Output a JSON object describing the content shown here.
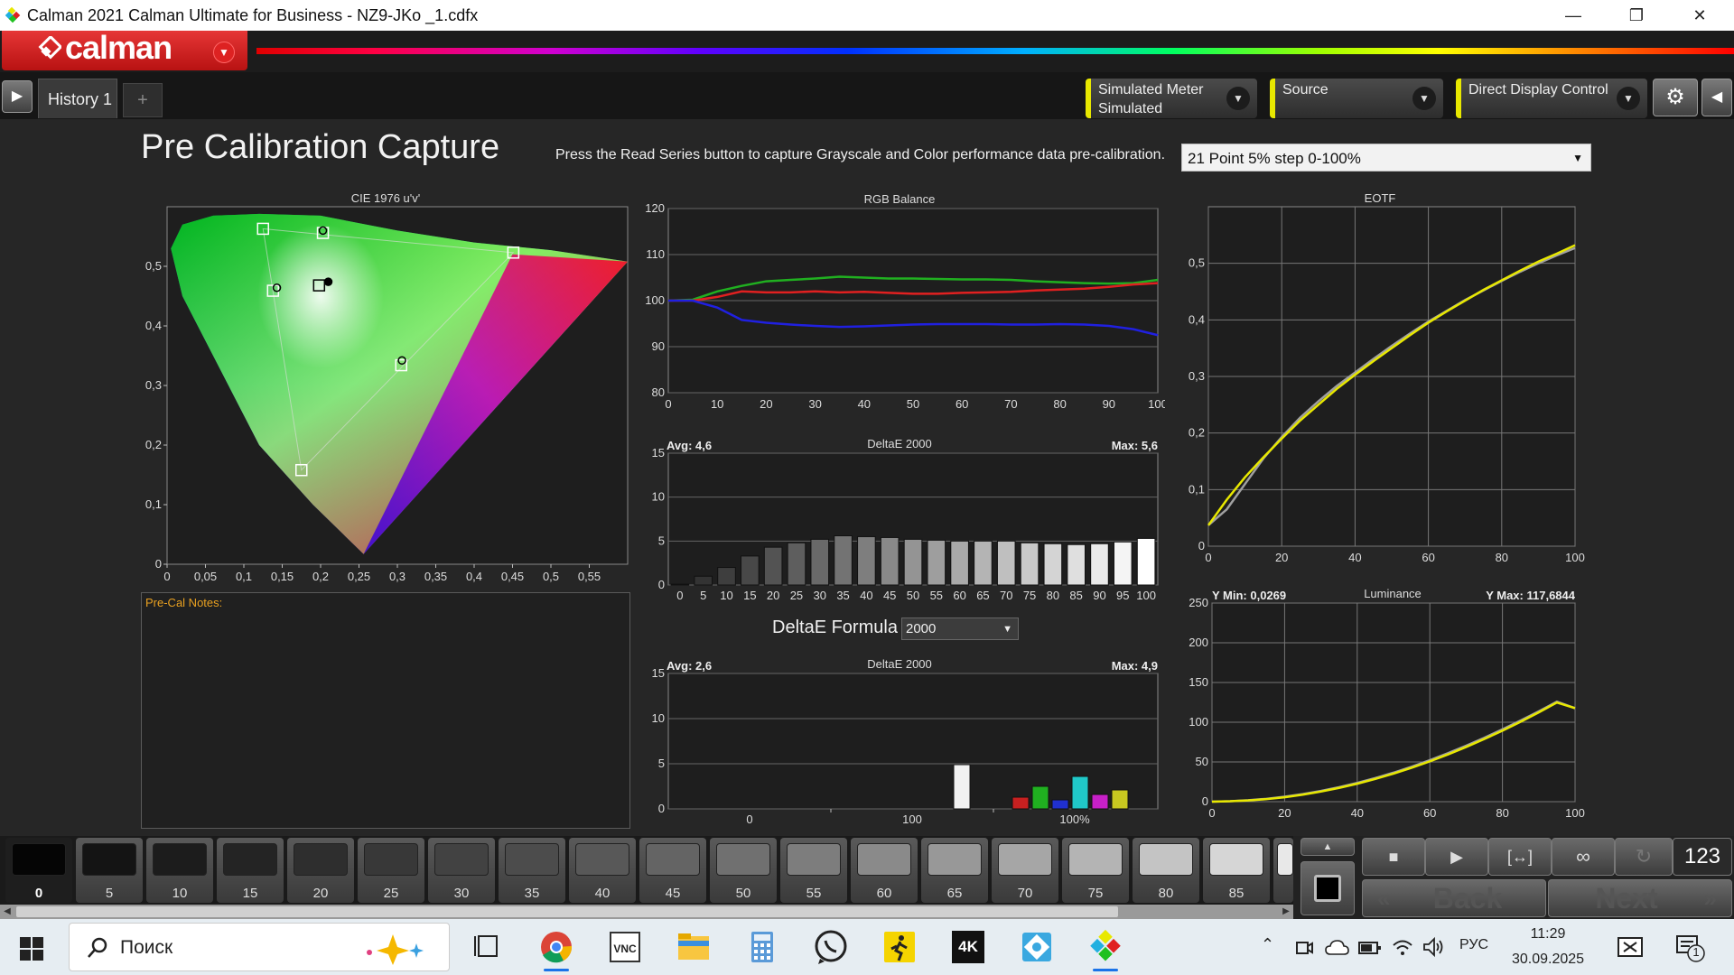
{
  "window": {
    "title": "Calman 2021 Calman Ultimate for Business  - NZ9-JKo _1.cdfx",
    "controls": [
      "—",
      "❐",
      "✕"
    ]
  },
  "logo": {
    "text": "calman"
  },
  "tabs": {
    "history_label": "History 1",
    "add_label": "+"
  },
  "devices": {
    "meter_label": "Simulated Meter",
    "meter_value": "Simulated",
    "source_label": "Source",
    "display_label": "Direct Display Control"
  },
  "page": {
    "title": "Pre Calibration Capture",
    "instructions": "Press the Read Series button to capture Grayscale and Color performance data pre-calibration.",
    "series_select": "21 Point 5% step 0-100%",
    "notes_label": "Pre-Cal Notes:",
    "deltae_formula_label": "DeltaE Formula",
    "deltae_formula_value": "2000"
  },
  "chart_data": [
    {
      "type": "scatter",
      "title": "CIE 1976 u'v'",
      "xlim": [
        0,
        0.6
      ],
      "ylim": [
        0,
        0.6
      ],
      "x_ticks": [
        "0",
        "0,05",
        "0,1",
        "0,15",
        "0,2",
        "0,25",
        "0,3",
        "0,35",
        "0,4",
        "0,45",
        "0,5",
        "0,55"
      ],
      "y_ticks": [
        "0",
        "0,1",
        "0,2",
        "0,3",
        "0,4",
        "0,5"
      ],
      "targets": [
        {
          "name": "red",
          "u": 0.451,
          "v": 0.523
        },
        {
          "name": "green",
          "u": 0.125,
          "v": 0.563
        },
        {
          "name": "blue",
          "u": 0.175,
          "v": 0.158
        },
        {
          "name": "white",
          "u": 0.198,
          "v": 0.468
        },
        {
          "name": "cyan",
          "u": 0.138,
          "v": 0.459
        },
        {
          "name": "magenta",
          "u": 0.305,
          "v": 0.334
        },
        {
          "name": "yellow",
          "u": 0.203,
          "v": 0.556
        }
      ],
      "measured": [
        {
          "name": "white",
          "u": 0.21,
          "v": 0.474
        },
        {
          "name": "cyan",
          "u": 0.143,
          "v": 0.464
        },
        {
          "name": "magenta",
          "u": 0.306,
          "v": 0.342
        },
        {
          "name": "yellow",
          "u": 0.203,
          "v": 0.56
        }
      ]
    },
    {
      "type": "line",
      "title": "RGB Balance",
      "x": [
        0,
        5,
        10,
        15,
        20,
        25,
        30,
        35,
        40,
        45,
        50,
        55,
        60,
        65,
        70,
        75,
        80,
        85,
        90,
        95,
        100
      ],
      "x_ticks": [
        "0",
        "10",
        "20",
        "30",
        "40",
        "50",
        "60",
        "70",
        "80",
        "90",
        "100"
      ],
      "y_ticks": [
        "80",
        "90",
        "100",
        "110",
        "120"
      ],
      "ylim": [
        80,
        120
      ],
      "series": [
        {
          "color": "#20b020",
          "values": [
            100,
            100.2,
            102,
            103.2,
            104.2,
            104.5,
            104.8,
            105.2,
            105,
            104.8,
            104.8,
            104.7,
            104.6,
            104.6,
            104.5,
            104.2,
            104,
            103.8,
            103.7,
            103.8,
            104.5
          ]
        },
        {
          "color": "#e02020",
          "values": [
            100,
            100,
            100.8,
            102,
            101.8,
            101.8,
            102,
            101.8,
            101.9,
            101.7,
            101.5,
            101.5,
            101.7,
            101.8,
            101.9,
            102.2,
            102.4,
            102.6,
            103,
            103.5,
            103.8
          ]
        },
        {
          "color": "#2020e0",
          "values": [
            100,
            100,
            98.5,
            95.8,
            95.2,
            94.8,
            94.5,
            94.3,
            94.4,
            94.6,
            94.8,
            94.9,
            94.9,
            94.9,
            94.8,
            94.8,
            94.9,
            94.8,
            94.5,
            93.8,
            92.5
          ]
        }
      ]
    },
    {
      "type": "bar",
      "title": "DeltaE 2000",
      "avg": "Avg: 4,6",
      "max": "Max: 5,6",
      "categories": [
        "0",
        "5",
        "10",
        "15",
        "20",
        "25",
        "30",
        "35",
        "40",
        "45",
        "50",
        "55",
        "60",
        "65",
        "70",
        "75",
        "80",
        "85",
        "90",
        "95",
        "100"
      ],
      "values": [
        0.1,
        1,
        2,
        3.3,
        4.3,
        4.8,
        5.2,
        5.6,
        5.5,
        5.4,
        5.2,
        5.1,
        5,
        5,
        5,
        4.8,
        4.7,
        4.6,
        4.7,
        4.9,
        5.3
      ],
      "y_ticks": [
        "0",
        "5",
        "10",
        "15"
      ],
      "ylim": [
        0,
        15
      ]
    },
    {
      "type": "bar",
      "title": "DeltaE 2000",
      "avg": "Avg: 2,6",
      "max": "Max: 4,9",
      "x_ticks": [
        "0",
        "100",
        "100%"
      ],
      "y_ticks": [
        "0",
        "5",
        "10",
        "15"
      ],
      "ylim": [
        0,
        15
      ],
      "bars": [
        {
          "name": "white",
          "color": "#f2f2f2",
          "value": 4.9
        },
        {
          "name": "red",
          "color": "#c82020",
          "value": 1.3
        },
        {
          "name": "green",
          "color": "#20b020",
          "value": 2.5
        },
        {
          "name": "blue",
          "color": "#2030d0",
          "value": 1
        },
        {
          "name": "cyan",
          "color": "#20c8c8",
          "value": 3.6
        },
        {
          "name": "magenta",
          "color": "#c820c8",
          "value": 1.6
        },
        {
          "name": "yellow",
          "color": "#c8c820",
          "value": 2.1
        }
      ]
    },
    {
      "type": "line",
      "title": "EOTF",
      "x": [
        0,
        5,
        10,
        15,
        20,
        25,
        30,
        35,
        40,
        45,
        50,
        55,
        60,
        65,
        70,
        75,
        80,
        85,
        90,
        95,
        100
      ],
      "x_ticks": [
        "0",
        "20",
        "40",
        "60",
        "80",
        "100"
      ],
      "y_ticks": [
        "0",
        "0,1",
        "0,2",
        "0,3",
        "0,4",
        "0,5"
      ],
      "ylim": [
        0,
        0.6
      ],
      "series": [
        {
          "color": "#e8e800",
          "values": [
            0.037,
            0.082,
            0.122,
            0.157,
            0.19,
            0.222,
            0.25,
            0.278,
            0.303,
            0.327,
            0.35,
            0.373,
            0.395,
            0.415,
            0.434,
            0.453,
            0.47,
            0.487,
            0.503,
            0.517,
            0.532
          ]
        },
        {
          "color": "#a0a0a0",
          "values": [
            0.037,
            0.065,
            0.11,
            0.155,
            0.193,
            0.227,
            0.256,
            0.283,
            0.307,
            0.331,
            0.354,
            0.376,
            0.397,
            0.416,
            0.435,
            0.452,
            0.469,
            0.485,
            0.5,
            0.514,
            0.527
          ]
        }
      ]
    },
    {
      "type": "line",
      "title": "Luminance",
      "ymin_label": "Y Min: 0,0269",
      "ymax_label": "Y Max: 117,6844",
      "x": [
        0,
        5,
        10,
        15,
        20,
        25,
        30,
        35,
        40,
        45,
        50,
        55,
        60,
        65,
        70,
        75,
        80,
        85,
        90,
        95,
        100
      ],
      "x_ticks": [
        "0",
        "20",
        "40",
        "60",
        "80",
        "100"
      ],
      "y_ticks": [
        "0",
        "50",
        "100",
        "150",
        "200",
        "250"
      ],
      "ylim": [
        0,
        250
      ],
      "series": [
        {
          "color": "#e8e800",
          "values": [
            0.03,
            0.5,
            1.5,
            3.2,
            5.6,
            8.8,
            12.7,
            17.3,
            22.6,
            28.6,
            35.3,
            42.7,
            50.7,
            59.4,
            68.8,
            78.8,
            89.4,
            100.6,
            112.4,
            124.8,
            117.7
          ]
        },
        {
          "color": "#a0a0a0",
          "values": [
            0.03,
            0.6,
            1.8,
            3.6,
            6.2,
            9.5,
            13.5,
            18.2,
            23.6,
            29.7,
            36.5,
            44,
            52.2,
            61,
            70.4,
            80.4,
            91,
            102.1,
            113.7,
            125.9,
            117.7
          ]
        }
      ]
    }
  ],
  "swatches": [
    {
      "label": "0",
      "color": "#050505"
    },
    {
      "label": "5",
      "color": "#141414"
    },
    {
      "label": "10",
      "color": "#1c1c1c"
    },
    {
      "label": "15",
      "color": "#242424"
    },
    {
      "label": "20",
      "color": "#2e2e2e"
    },
    {
      "label": "25",
      "color": "#383838"
    },
    {
      "label": "30",
      "color": "#424242"
    },
    {
      "label": "35",
      "color": "#4c4c4c"
    },
    {
      "label": "40",
      "color": "#585858"
    },
    {
      "label": "45",
      "color": "#646464"
    },
    {
      "label": "50",
      "color": "#707070"
    },
    {
      "label": "55",
      "color": "#7d7d7d"
    },
    {
      "label": "60",
      "color": "#8a8a8a"
    },
    {
      "label": "65",
      "color": "#989898"
    },
    {
      "label": "70",
      "color": "#a6a6a6"
    },
    {
      "label": "75",
      "color": "#b4b4b4"
    },
    {
      "label": "80",
      "color": "#c4c4c4"
    },
    {
      "label": "85",
      "color": "#d6d6d6"
    }
  ],
  "controls": {
    "counter": "123",
    "back_label": "Back",
    "next_label": "Next"
  },
  "taskbar": {
    "search_placeholder": "Поиск",
    "language": "РУС",
    "time": "11:29",
    "date": "30.09.2025",
    "notification_count": "1"
  }
}
